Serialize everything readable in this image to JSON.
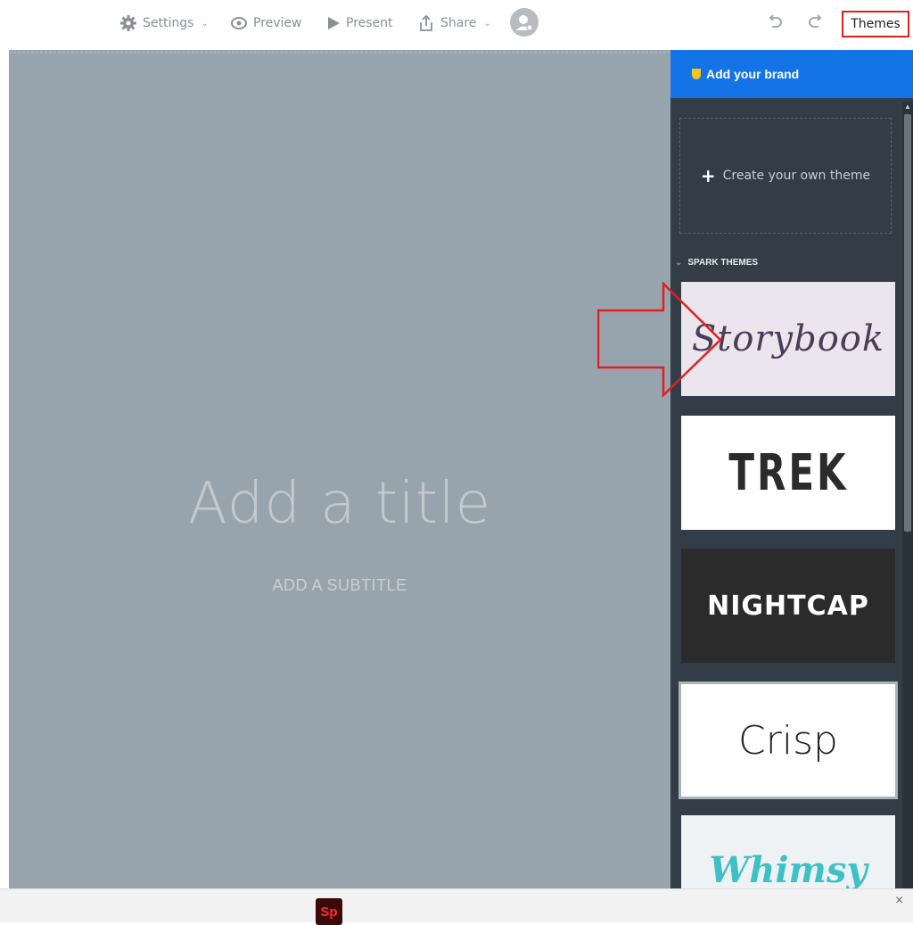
{
  "toolbar": {
    "settings_label": "Settings",
    "preview_label": "Preview",
    "present_label": "Present",
    "share_label": "Share",
    "themes_label": "Themes"
  },
  "canvas": {
    "title_placeholder": "Add a title",
    "subtitle_placeholder": "ADD A SUBTITLE"
  },
  "panel": {
    "brand_label": "Add your brand",
    "create_theme_label": "Create your own theme",
    "section_label": "SPARK THEMES",
    "themes": [
      {
        "name": "Storybook"
      },
      {
        "name": "TREK"
      },
      {
        "name": "NIGHTCAP"
      },
      {
        "name": "Crisp"
      },
      {
        "name": "Whimsy"
      }
    ]
  },
  "bottom": {
    "app_logo_text": "Sp",
    "close_symbol": "×"
  },
  "colors": {
    "brand_blue": "#1473e6",
    "panel_bg": "#323d47",
    "canvas_bg": "#98a4ad",
    "highlight_red": "#e02020"
  },
  "icons": [
    "gear-icon",
    "eye-icon",
    "play-icon",
    "share-icon",
    "avatar-icon",
    "undo-icon",
    "redo-icon",
    "plus-icon",
    "shield-icon",
    "close-icon"
  ]
}
